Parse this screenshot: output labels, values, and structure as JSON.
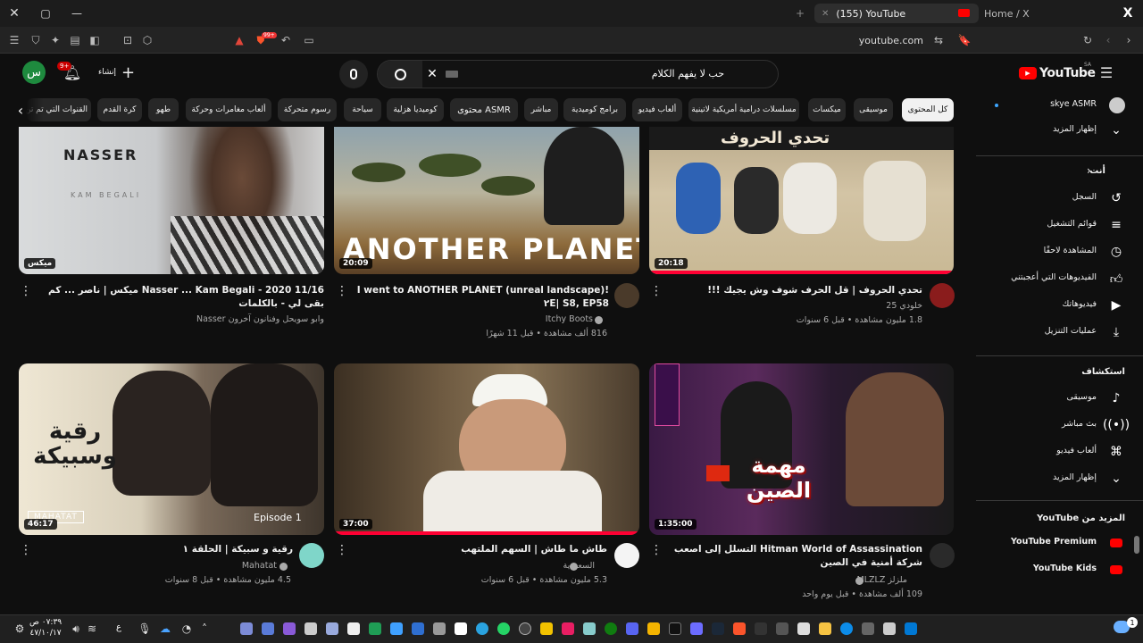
{
  "browser": {
    "active_tab": "(155) YouTube",
    "other_tab": "Home / X",
    "url": "youtube.com",
    "brave_badge": "99+"
  },
  "masthead": {
    "logo_text": "YouTube",
    "logo_region": "SA",
    "search_value": "حب لا يفهم الكلام",
    "create_label": "إنشاء",
    "notifications_count": "9+",
    "avatar_letter": "س"
  },
  "chips": [
    "كل المحتوى",
    "موسيقى",
    "ميكسات",
    "مسلسلات درامية أمريكية لاتينية",
    "ألعاب فيديو",
    "برامج كوميدية",
    "مباشر",
    "محتوى ASMR",
    "كوميديا هزلية",
    "سياحة",
    "رسوم متحركة",
    "ألعاب مغامرات وحركة",
    "طهو",
    "كرة القدم",
    "القنوات التي تم تن"
  ],
  "videos": [
    {
      "title": "Nasser ... Kam Begali - 2020 11/16 ميكس | ناصر ... كم بقى لي - بالكلمات",
      "channel": "وابو سويحل وفنانون آخرون Nasser",
      "stats": "",
      "duration": "ميكس",
      "thumb_text": "NASSER",
      "thumb_sub": "KAM BEGALI"
    },
    {
      "title": "I went to ANOTHER PLANET (unreal landscape)! ۲E| S8, EP58",
      "channel": "Itchy Boots",
      "stats": "816 ألف مشاهدة • قبل 11 شهرًا",
      "duration": "20:09",
      "thumb_text": "ANOTHER PLANET"
    },
    {
      "title": "تحدي الحروف | قل الحرف شوف وش يجيك !!!",
      "channel": "خلودي 25",
      "stats": "1.8 مليون مشاهدة • قبل 6 سنوات",
      "duration": "20:18",
      "thumb_text": "تحدي الحروف"
    },
    {
      "title": "رقية و سبيكة | الحلقة ١",
      "channel": "Mahatat",
      "stats": "4.5 مليون مشاهدة • قبل 8 سنوات",
      "duration": "46:17",
      "thumb_text": "رقية وسبيكة",
      "thumb_sub": "Episode 1",
      "thumb_logo": "MAHATAT"
    },
    {
      "title": "طاش ما طاش | السهم الملتهب",
      "channel": "السعودية",
      "stats": "5.3 مليون مشاهدة • قبل 6 سنوات",
      "duration": "37:00"
    },
    {
      "title": "Hitman World of Assassination التسلل إلى اصعب شركة أمنية في الصين",
      "channel": "ملزلز MLZLZ",
      "stats": "109 ألف مشاهدة • قبل يوم واحد",
      "duration": "1:35:00",
      "thumb_text": "مهمة الصين"
    }
  ],
  "sidebar": {
    "subscription": "skye ASMR",
    "show_more": "إظهار المزيد",
    "you_heading": "أنت",
    "you_items": [
      "السجل",
      "قوائم التشغيل",
      "المشاهدة لاحقًا",
      "الفيديوهات التي أعجبتني",
      "فيديوهاتك",
      "عمليات التنزيل"
    ],
    "explore_heading": "استكشاف",
    "explore_items": [
      "موسيقى",
      "بث مباشر",
      "ألعاب فيديو",
      "إظهار المزيد"
    ],
    "more_heading": "المزيد من YouTube",
    "more_items": [
      "YouTube Premium",
      "YouTube Kids"
    ]
  },
  "taskbar": {
    "time": "٠٧:٣٩ ص",
    "date": "٤٧/١٠/١٧",
    "lang": "ع",
    "notif_count": "1"
  },
  "colors": {
    "bg": "#0f0f0f",
    "brand_red": "#ff0000",
    "chip_bg": "#272727"
  }
}
